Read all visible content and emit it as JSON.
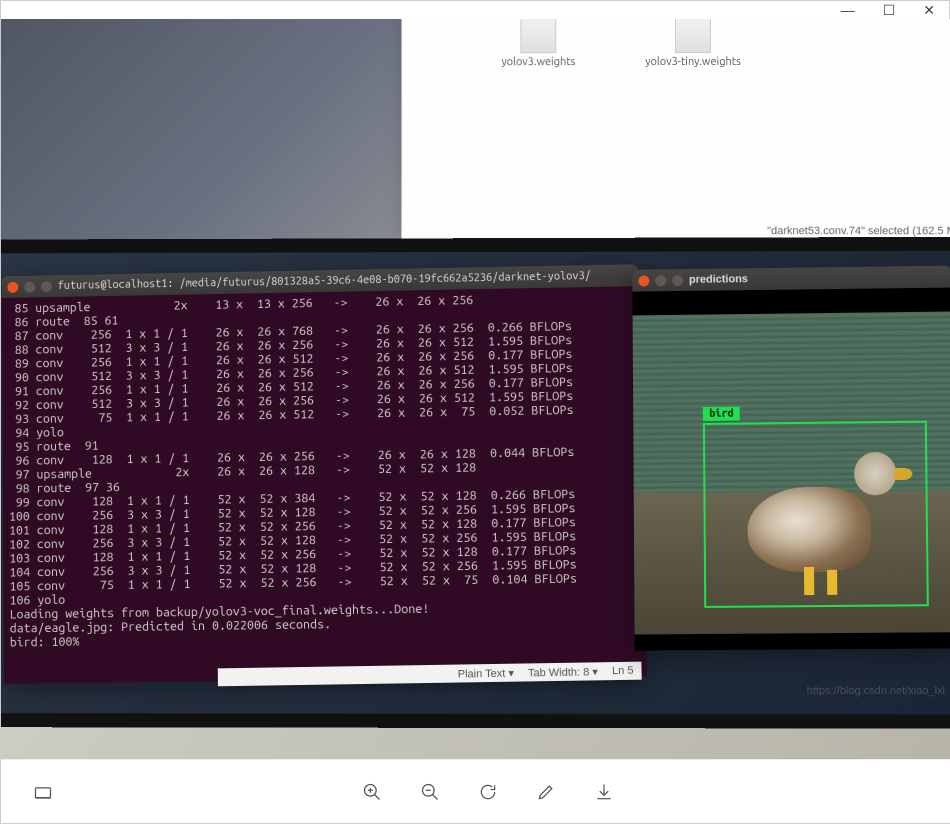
{
  "window_controls": {
    "minimize": "—",
    "maximize": "☐",
    "close": "✕"
  },
  "file_window": {
    "files": [
      {
        "name": "yolov3.weights"
      },
      {
        "name": "yolov3-tiny.weights"
      }
    ],
    "status": "\"darknet53.conv.74\" selected  (162.5 M"
  },
  "terminal": {
    "title": "futurus@localhost1: /media/futurus/801328a5-39c6-4e08-b070-19fc662a5236/darknet-yolov3/",
    "body": " 85 upsample            2x    13 x  13 x 256   ->    26 x  26 x 256\n 86 route  85 61\n 87 conv    256  1 x 1 / 1    26 x  26 x 768   ->    26 x  26 x 256  0.266 BFLOPs\n 88 conv    512  3 x 3 / 1    26 x  26 x 256   ->    26 x  26 x 512  1.595 BFLOPs\n 89 conv    256  1 x 1 / 1    26 x  26 x 512   ->    26 x  26 x 256  0.177 BFLOPs\n 90 conv    512  3 x 3 / 1    26 x  26 x 256   ->    26 x  26 x 512  1.595 BFLOPs\n 91 conv    256  1 x 1 / 1    26 x  26 x 512   ->    26 x  26 x 256  0.177 BFLOPs\n 92 conv    512  3 x 3 / 1    26 x  26 x 256   ->    26 x  26 x 512  1.595 BFLOPs\n 93 conv     75  1 x 1 / 1    26 x  26 x 512   ->    26 x  26 x  75  0.052 BFLOPs\n 94 yolo\n 95 route  91\n 96 conv    128  1 x 1 / 1    26 x  26 x 256   ->    26 x  26 x 128  0.044 BFLOPs\n 97 upsample            2x    26 x  26 x 128   ->    52 x  52 x 128\n 98 route  97 36\n 99 conv    128  1 x 1 / 1    52 x  52 x 384   ->    52 x  52 x 128  0.266 BFLOPs\n100 conv    256  3 x 3 / 1    52 x  52 x 128   ->    52 x  52 x 256  1.595 BFLOPs\n101 conv    128  1 x 1 / 1    52 x  52 x 256   ->    52 x  52 x 128  0.177 BFLOPs\n102 conv    256  3 x 3 / 1    52 x  52 x 128   ->    52 x  52 x 256  1.595 BFLOPs\n103 conv    128  1 x 1 / 1    52 x  52 x 256   ->    52 x  52 x 128  0.177 BFLOPs\n104 conv    256  3 x 3 / 1    52 x  52 x 128   ->    52 x  52 x 256  1.595 BFLOPs\n105 conv     75  1 x 1 / 1    52 x  52 x 256   ->    52 x  52 x  75  0.104 BFLOPs\n106 yolo\nLoading weights from backup/yolov3-voc_final.weights...Done!\ndata/eagle.jpg: Predicted in 0.022006 seconds.\nbird: 100%"
  },
  "editor_bar": {
    "mode": "Plain Text ▾",
    "tab": "Tab Width: 8 ▾",
    "line": "Ln 5"
  },
  "predictions": {
    "title": "predictions",
    "detection_label": "bird"
  },
  "watermark": "https://blog.csdn.net/xiao_lxl",
  "toolbar_icons": [
    "one-to-one",
    "zoom-in",
    "zoom-out",
    "rotate",
    "edit",
    "download"
  ]
}
